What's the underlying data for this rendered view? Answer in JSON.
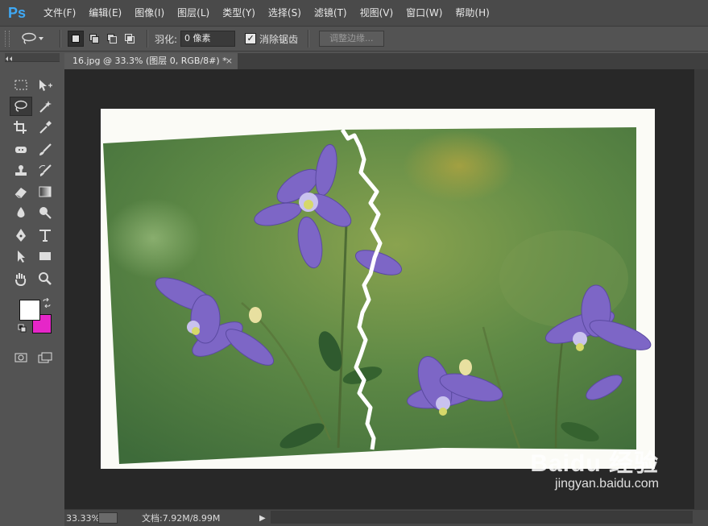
{
  "app": {
    "logo": "Ps"
  },
  "menu": [
    "文件(F)",
    "编辑(E)",
    "图像(I)",
    "图层(L)",
    "类型(Y)",
    "选择(S)",
    "滤镜(T)",
    "视图(V)",
    "窗口(W)",
    "帮助(H)"
  ],
  "options": {
    "feather_label": "羽化:",
    "feather_value": "0 像素",
    "antialias_label": "消除锯齿",
    "antialias_checked": "✓",
    "refine_edge_label": "调整边缘..."
  },
  "document": {
    "tab_title": "16.jpg @ 33.3% (图层 0, RGB/8#) *",
    "tab_close": "×"
  },
  "status": {
    "zoom": "33.33%",
    "doc_info": "文档:7.92M/8.99M",
    "arrow": "▶"
  },
  "colors": {
    "foreground": "#ffffff",
    "background": "#e626c8",
    "accent": "#3fa9f5"
  },
  "watermark": {
    "logo": "Baidu 经验",
    "url": "jingyan.baidu.com"
  }
}
